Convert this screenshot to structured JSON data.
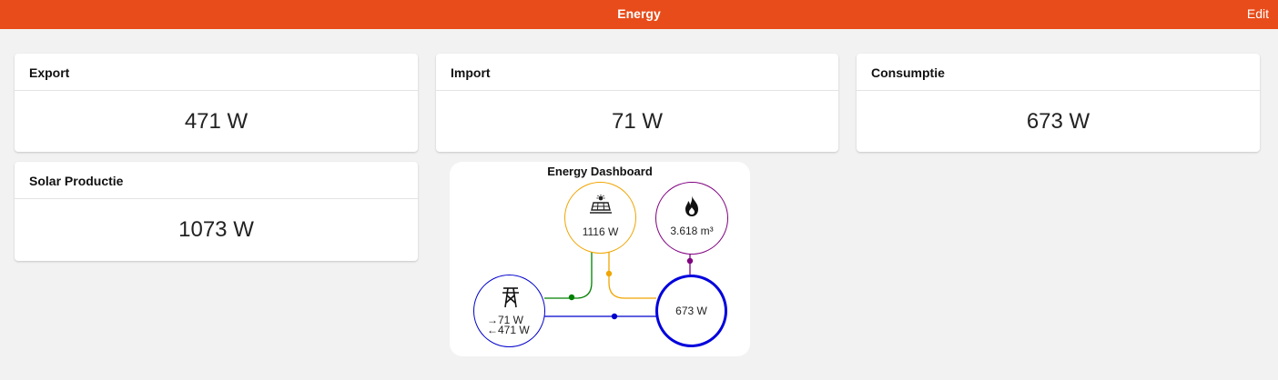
{
  "header": {
    "title": "Energy",
    "edit_label": "Edit"
  },
  "cards": [
    {
      "title": "Export",
      "value": "471 W"
    },
    {
      "title": "Import",
      "value": "71 W"
    },
    {
      "title": "Consumptie",
      "value": "673 W"
    },
    {
      "title": "Solar Productie",
      "value": "1073 W"
    }
  ],
  "energy_dashboard": {
    "title": "Energy Dashboard",
    "solar": {
      "value": "1116 W",
      "icon": "solar-panel-icon"
    },
    "gas": {
      "value": "3.618 m³",
      "icon": "fire-icon"
    },
    "grid": {
      "import": "→71 W",
      "export": "←471 W",
      "icon": "transmission-tower-icon"
    },
    "home": {
      "value": "673 W"
    },
    "colors": {
      "solar": "#f0a500",
      "gas": "#800080",
      "grid": "#0000cc",
      "home": "#0000dd",
      "return": "#008000"
    }
  }
}
